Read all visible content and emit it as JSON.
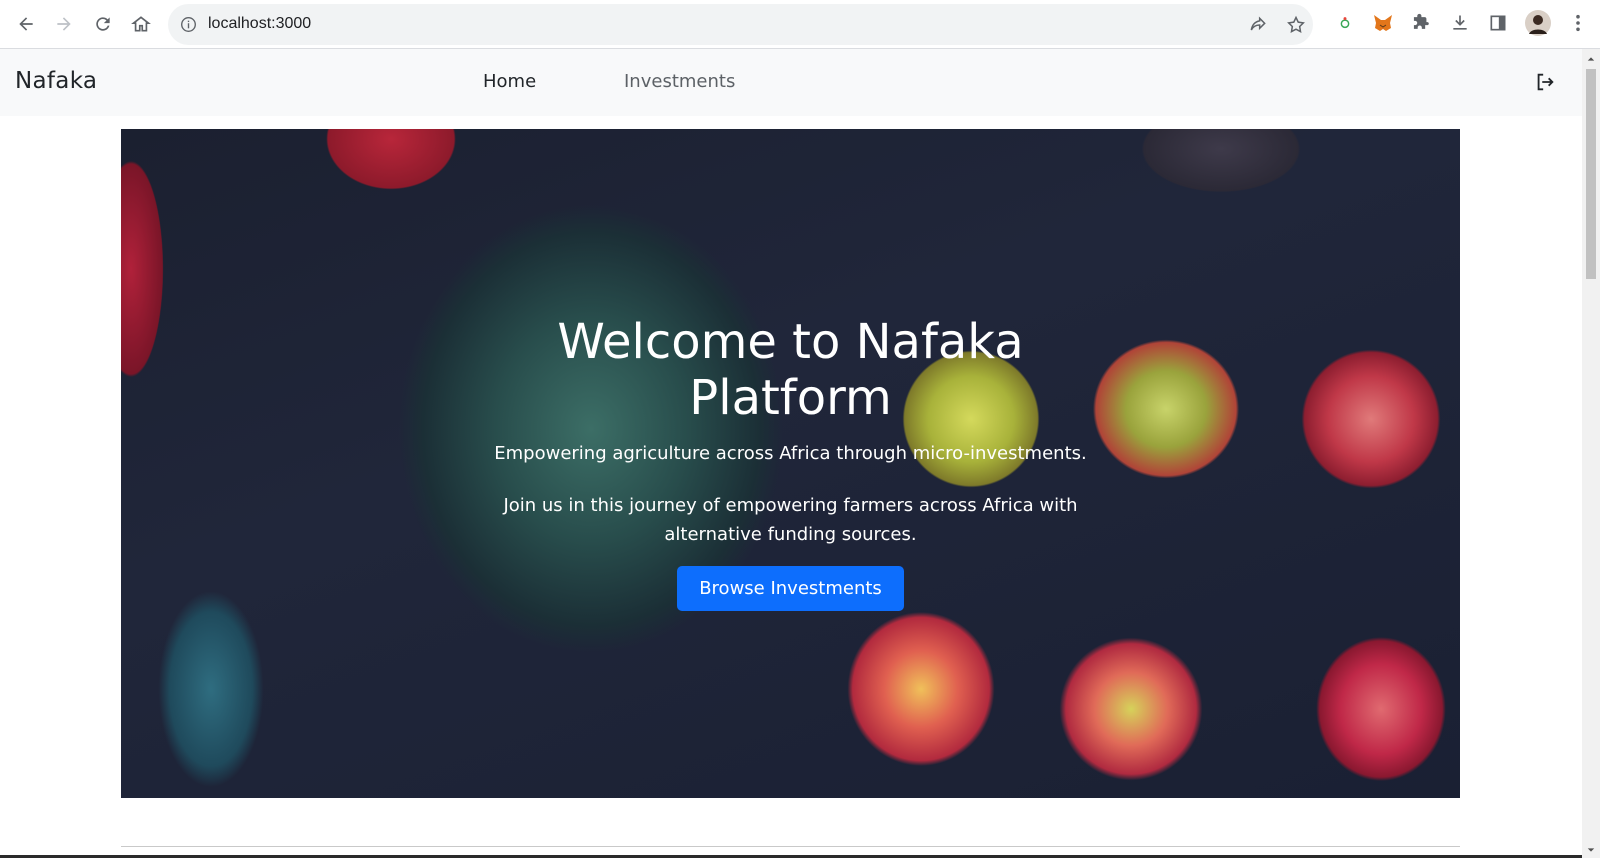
{
  "browser": {
    "url": "localhost:3000"
  },
  "navbar": {
    "brand": "Nafaka",
    "links": [
      {
        "label": "Home"
      },
      {
        "label": "Investments"
      }
    ]
  },
  "hero": {
    "title": "Welcome to Nafaka Platform",
    "subtitle": "Empowering agriculture across Africa through micro-investments.",
    "description": "Join us in this journey of empowering farmers across Africa with alternative funding sources.",
    "button_label": "Browse Investments"
  },
  "colors": {
    "accent": "#0d6efd",
    "navbar_bg": "#f8f9fa"
  }
}
